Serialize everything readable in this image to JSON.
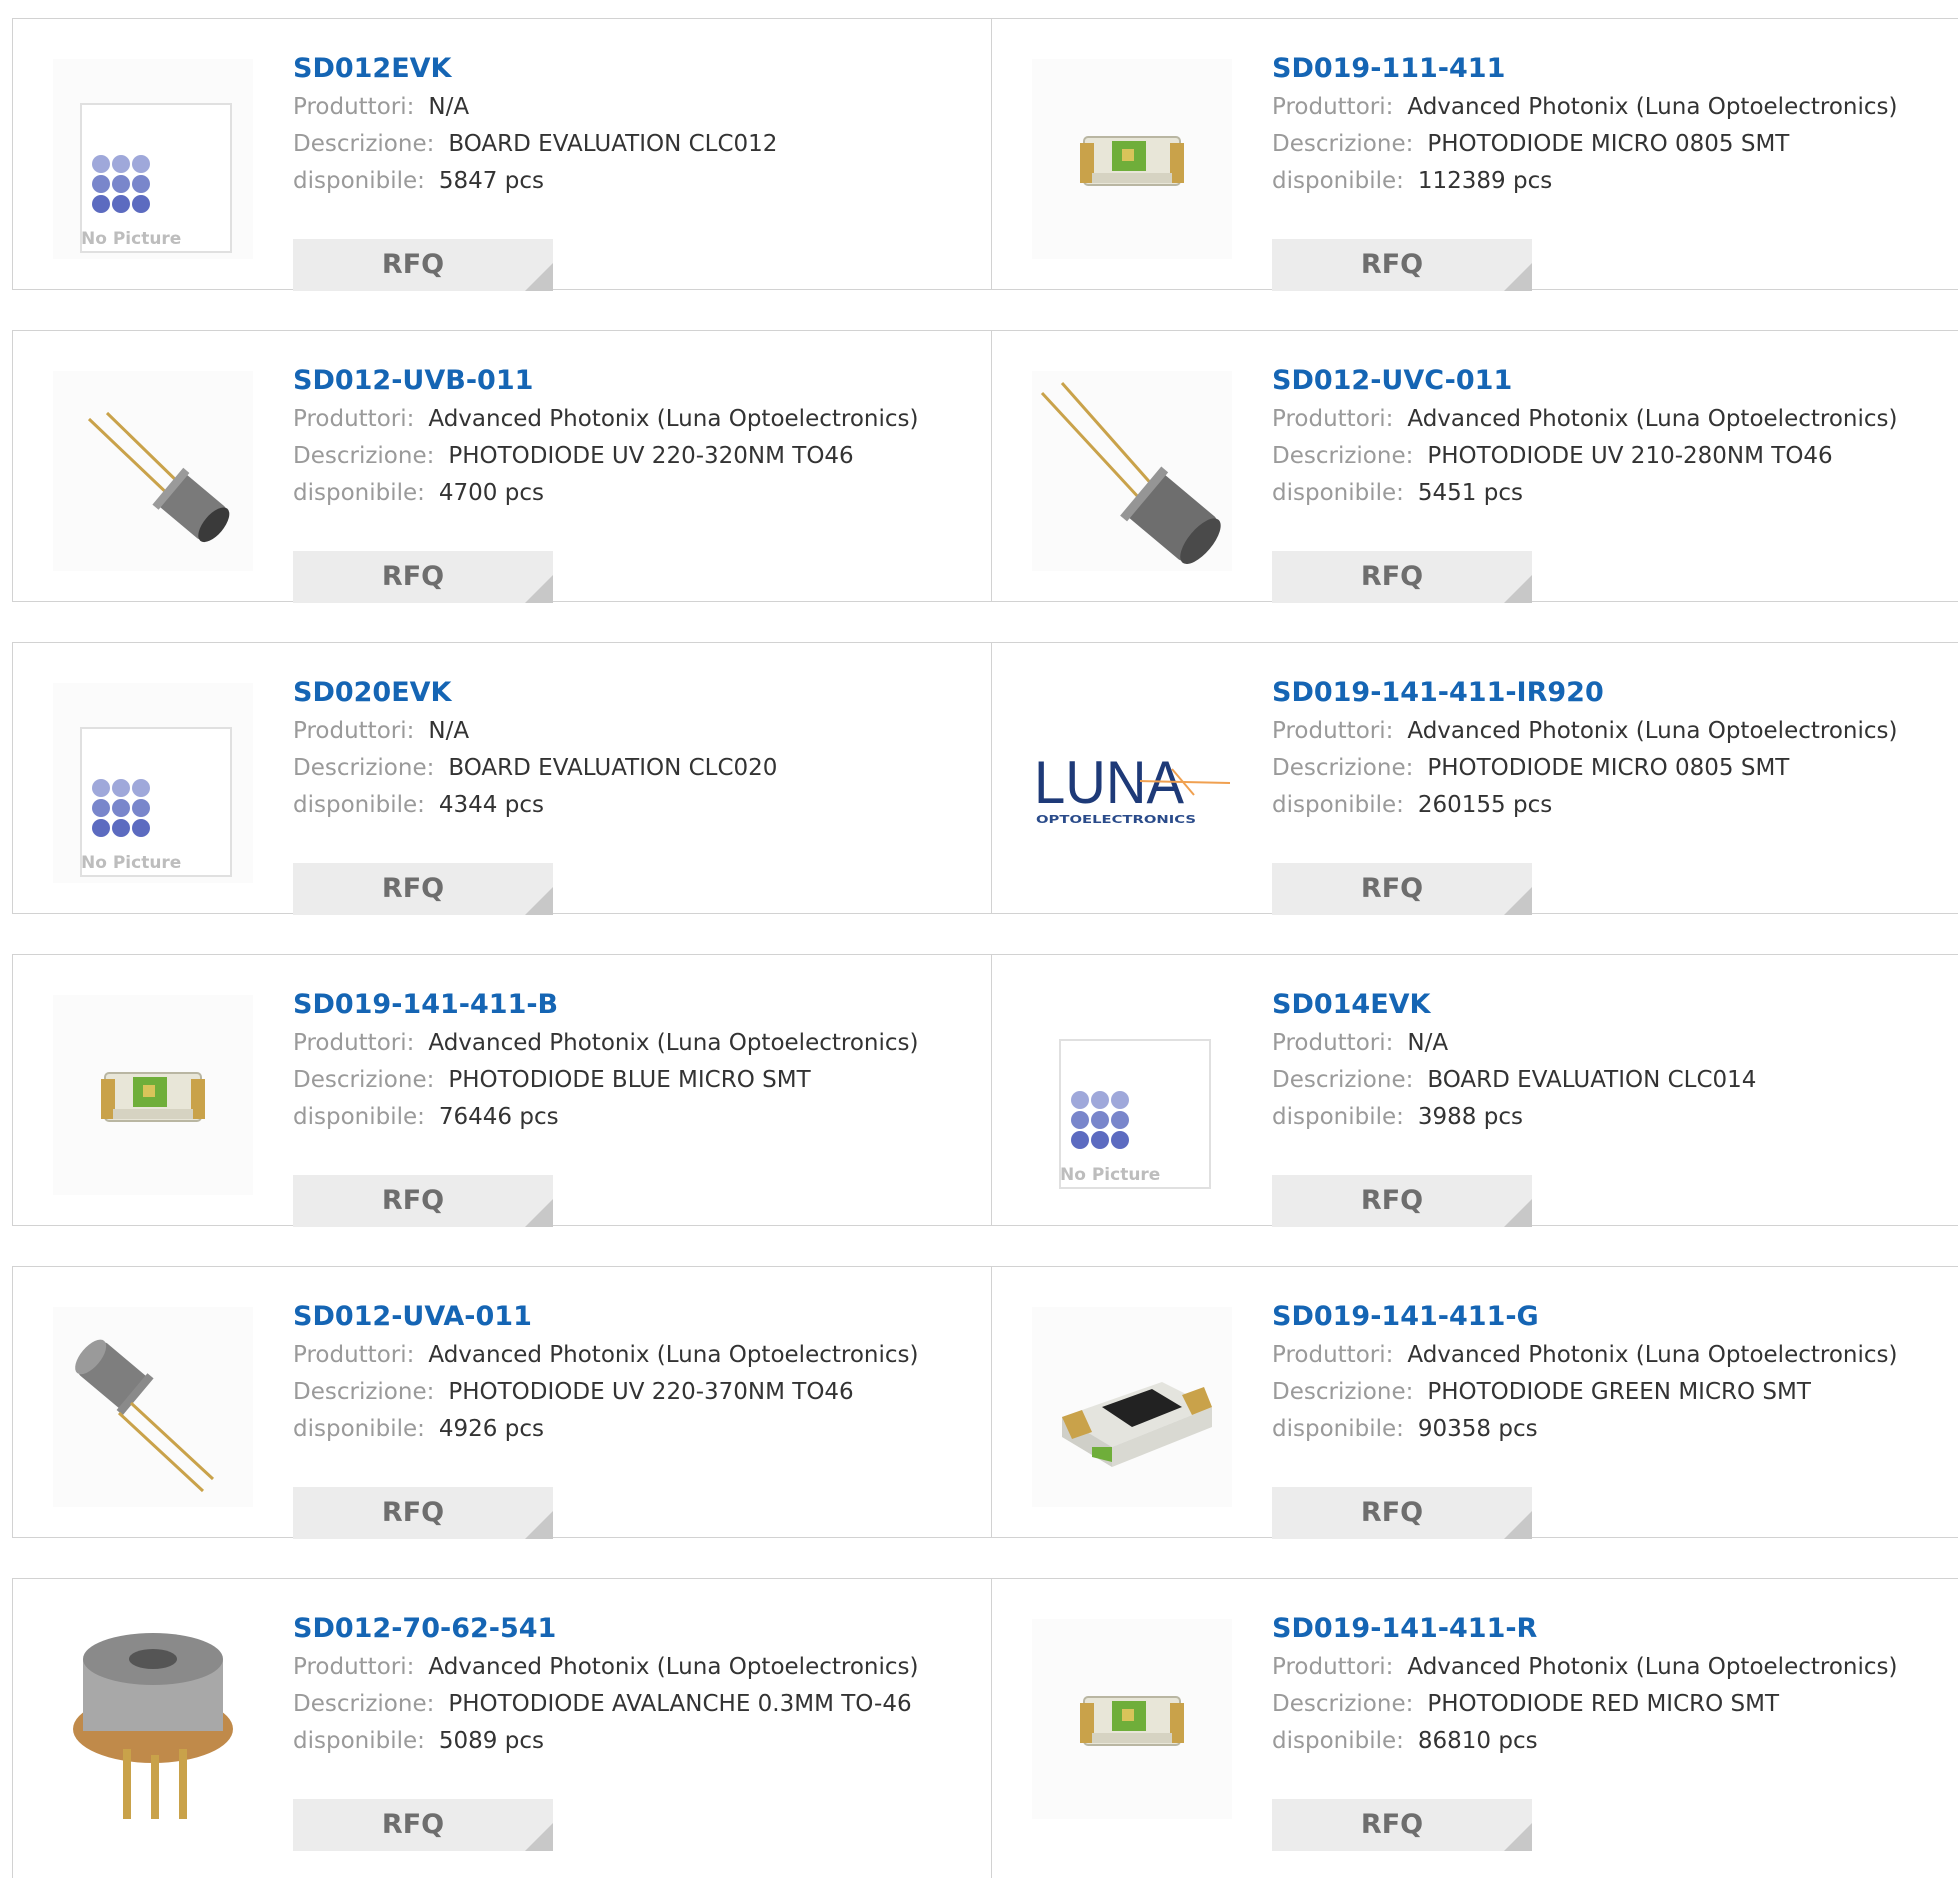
{
  "labels": {
    "manufacturer": "Produttori:",
    "description": "Descrizione:",
    "available": "disponibile:",
    "rfq": "RFQ",
    "no_picture": "No Picture",
    "luna_brand": "LUNA",
    "luna_sub": "OPTOELECTRONICS"
  },
  "products": [
    {
      "name": "SD012EVK",
      "manufacturer": "N/A",
      "description": "BOARD EVALUATION CLC012",
      "stock": "5847 pcs",
      "image": "no-picture"
    },
    {
      "name": "SD019-111-411",
      "manufacturer": "Advanced Photonix (Luna Optoelectronics)",
      "description": "PHOTODIODE MICRO 0805 SMT",
      "stock": "112389 pcs",
      "image": "smt-photodiode"
    },
    {
      "name": "SD012-UVB-011",
      "manufacturer": "Advanced Photonix (Luna Optoelectronics)",
      "description": "PHOTODIODE UV 220-320NM TO46",
      "stock": "4700 pcs",
      "image": "to46-can-small"
    },
    {
      "name": "SD012-UVC-011",
      "manufacturer": "Advanced Photonix (Luna Optoelectronics)",
      "description": "PHOTODIODE UV 210-280NM TO46",
      "stock": "5451 pcs",
      "image": "to46-can-large"
    },
    {
      "name": "SD020EVK",
      "manufacturer": "N/A",
      "description": "BOARD EVALUATION CLC020",
      "stock": "4344 pcs",
      "image": "no-picture"
    },
    {
      "name": "SD019-141-411-IR920",
      "manufacturer": "Advanced Photonix (Luna Optoelectronics)",
      "description": "PHOTODIODE MICRO 0805 SMT",
      "stock": "260155 pcs",
      "image": "luna-logo"
    },
    {
      "name": "SD019-141-411-B",
      "manufacturer": "Advanced Photonix (Luna Optoelectronics)",
      "description": "PHOTODIODE BLUE MICRO SMT",
      "stock": "76446 pcs",
      "image": "smt-photodiode"
    },
    {
      "name": "SD014EVK",
      "manufacturer": "N/A",
      "description": "BOARD EVALUATION CLC014",
      "stock": "3988 pcs",
      "image": "no-picture"
    },
    {
      "name": "SD012-UVA-011",
      "manufacturer": "Advanced Photonix (Luna Optoelectronics)",
      "description": "PHOTODIODE UV 220-370NM TO46",
      "stock": "4926 pcs",
      "image": "to46-can-reversed"
    },
    {
      "name": "SD019-141-411-G",
      "manufacturer": "Advanced Photonix (Luna Optoelectronics)",
      "description": "PHOTODIODE GREEN MICRO SMT",
      "stock": "90358 pcs",
      "image": "smt-dark-chip"
    },
    {
      "name": "SD012-70-62-541",
      "manufacturer": "Advanced Photonix (Luna Optoelectronics)",
      "description": "PHOTODIODE AVALANCHE 0.3MM TO-46",
      "stock": "5089 pcs",
      "image": "to46-three-leads"
    },
    {
      "name": "SD019-141-411-R",
      "manufacturer": "Advanced Photonix (Luna Optoelectronics)",
      "description": "PHOTODIODE RED MICRO SMT",
      "stock": "86810 pcs",
      "image": "smt-photodiode"
    }
  ],
  "colors": {
    "title": "#1565b4",
    "label": "#9a9a9a",
    "value": "#333333",
    "rfq_bg": "#ececec",
    "border": "#d2d2d2"
  }
}
